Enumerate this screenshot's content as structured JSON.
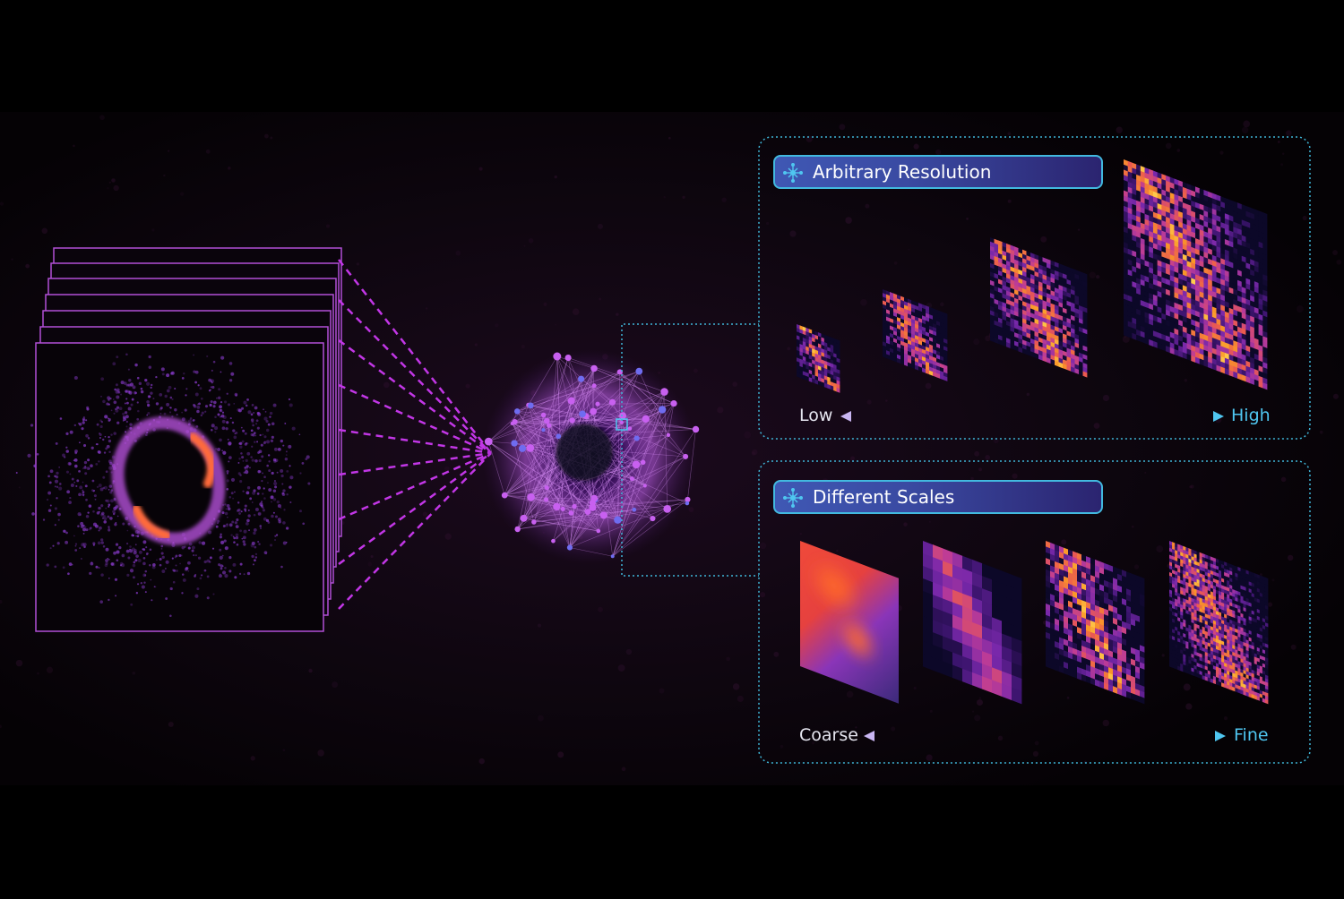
{
  "panels": {
    "resolution": {
      "title": "Arbitrary Resolution",
      "low_label": "Low",
      "high_label": "High"
    },
    "scales": {
      "title": "Different Scales",
      "low_label": "Coarse",
      "high_label": "Fine"
    }
  },
  "colors": {
    "background": "#000000",
    "panel_border": "#3fb6d8",
    "title_border": "#42b9df",
    "stack_border": "#b14fd6",
    "connector": "#c236e6",
    "arrow_left": "#c9b6f2",
    "arrow_right": "#4fc6f0"
  },
  "icons": {
    "panel_title_icon": "network-node-icon"
  }
}
